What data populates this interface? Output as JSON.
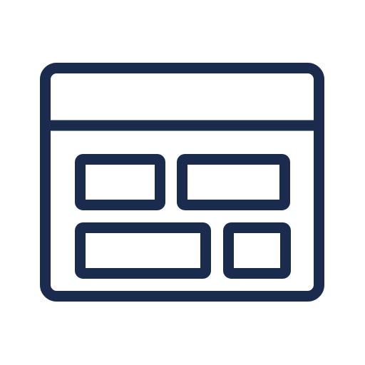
{
  "icon": {
    "name": "dashboard-layout-icon",
    "stroke_color": "#1b2b4d",
    "background_color": "#ffffff"
  }
}
